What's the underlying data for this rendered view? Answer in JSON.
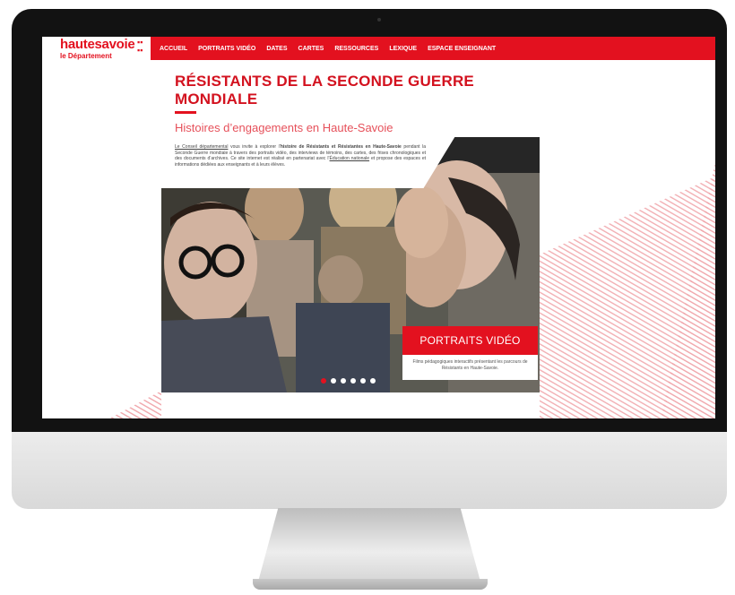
{
  "site": {
    "logo_main": "hautesavoie",
    "logo_dots": "▪▪\n▪▪",
    "logo_sub": "le Département"
  },
  "nav": {
    "items": [
      "ACCUEIL",
      "PORTRAITS VIDÉO",
      "DATES",
      "CARTES",
      "RESSOURCES",
      "LEXIQUE",
      "ESPACE ENSEIGNANT"
    ]
  },
  "hero": {
    "title": "RÉSISTANTS DE LA SECONDE GUERRE MONDIALE",
    "subtitle": "Histoires d’engagements en Haute-Savoie",
    "intro": {
      "link_1": "Le Conseil départemental",
      "text_1": " vous invite à explorer l’",
      "bold_1": "histoire de Résistants et Résistantes en Haute-Savoie",
      "text_2": " pendant la Seconde Guerre mondiale à travers des portraits vidéo, des interviews de témoins, des cartes, des frises chronologiques et des documents d’archives. Ce site internet est réalisé en partenariat avec l’",
      "link_2": "Éducation nationale",
      "text_3": " et propose des espaces et informations dédiées aux enseignants et à leurs élèves."
    }
  },
  "slide": {
    "title": "PORTRAITS VIDÉO",
    "description": "Films pédagogiques interactifs présentant les parcours de Résistants en Haute-Savoie.",
    "count": 6,
    "active_index": 0
  },
  "colors": {
    "accent": "#e3111f",
    "bezel": "#121212"
  }
}
